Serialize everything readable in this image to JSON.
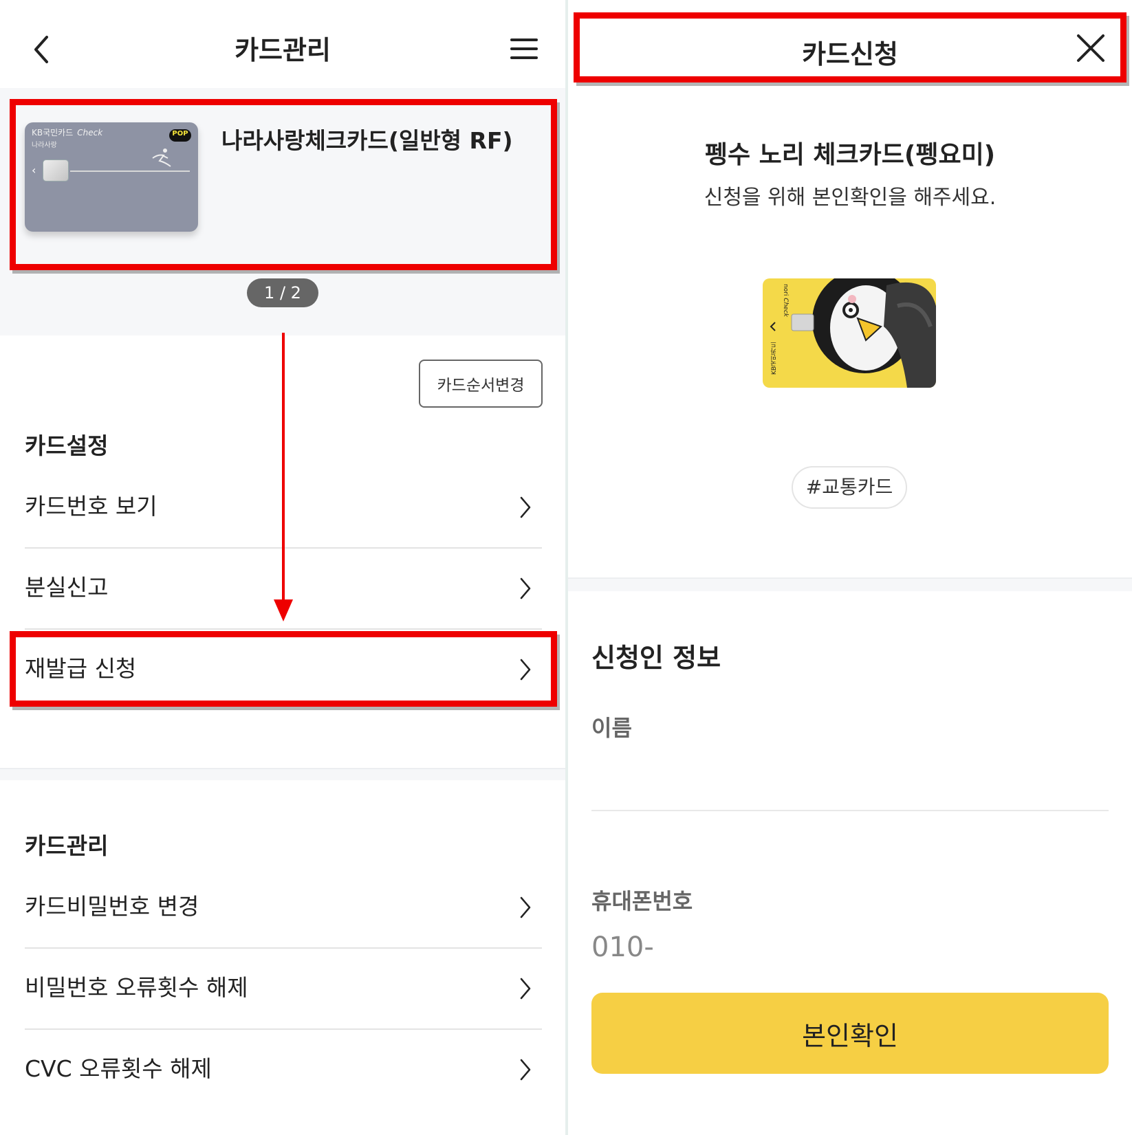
{
  "left": {
    "header": {
      "title": "카드관리"
    },
    "card": {
      "brand": "KB국민카드",
      "brand_type": "Check",
      "brand_sub": "나라사랑",
      "badge": "POP",
      "name": "나라사랑체크카드(일반형 RF)",
      "color": "#8e93a4"
    },
    "pager": "1 / 2",
    "order_button": "카드순서변경",
    "sections": [
      {
        "title": "카드설정",
        "items": [
          "카드번호 보기",
          "분실신고",
          "재발급 신청"
        ]
      },
      {
        "title": "카드관리",
        "items": [
          "카드비밀번호 변경",
          "비밀번호 오류횟수 해제",
          "CVC 오류횟수 해제"
        ]
      }
    ],
    "highlight_color": "#ee0000"
  },
  "right": {
    "header": {
      "title": "카드신청"
    },
    "card_name": "펭수 노리 체크카드(펭요미)",
    "subtitle": "신청을 위해 본인확인을 해주세요.",
    "card": {
      "brand": "KB국민카드",
      "text_top": "nori",
      "text_type": "Check",
      "color": "#f4d949"
    },
    "tag": "#교통카드",
    "form": {
      "section_title": "신청인 정보",
      "name_label": "이름",
      "phone_label": "휴대폰번호",
      "phone_value": "010-",
      "submit_label": "본인확인",
      "submit_color": "#f6cf44"
    }
  }
}
